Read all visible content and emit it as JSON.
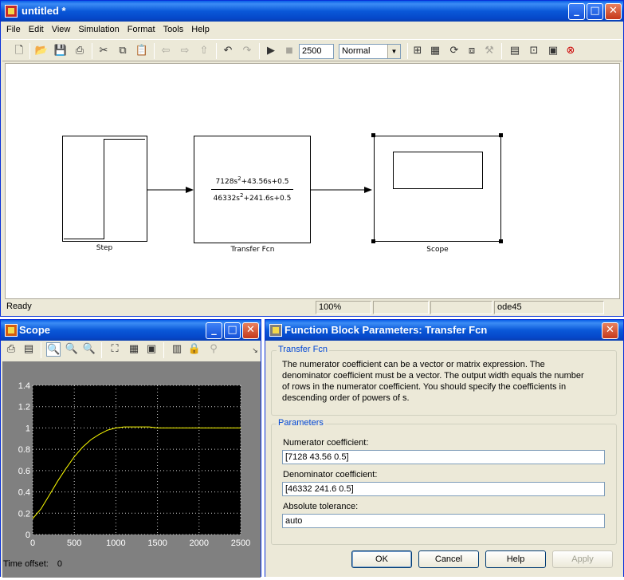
{
  "model": {
    "title": "untitled *",
    "menu": [
      "File",
      "Edit",
      "View",
      "Simulation",
      "Format",
      "Tools",
      "Help"
    ],
    "stop_time": "2500",
    "sim_mode": "Normal",
    "blocks": {
      "step": {
        "label": "Step"
      },
      "tf": {
        "label": "Transfer Fcn",
        "num_a": "7128s",
        "num_b": "+43.56s+0.5",
        "den_a": "46332s",
        "den_b": "+241.6s+0.5",
        "exp": "2"
      },
      "scope": {
        "label": "Scope"
      }
    },
    "status": {
      "ready": "Ready",
      "zoom": "100%",
      "solver": "ode45"
    }
  },
  "scope": {
    "title": "Scope",
    "time_offset_label": "Time offset:",
    "time_offset_value": "0",
    "chart_data": {
      "type": "line",
      "title": "",
      "xlabel": "",
      "ylabel": "",
      "xlim": [
        0,
        2500
      ],
      "ylim": [
        0,
        1.4
      ],
      "xticks": [
        0,
        500,
        1000,
        1500,
        2000,
        2500
      ],
      "yticks": [
        0,
        0.2,
        0.4,
        0.6,
        0.8,
        1,
        1.2,
        1.4
      ],
      "ytick_labels": [
        "0",
        "0.2",
        "0.4",
        "0.6",
        "0.8",
        "1",
        "1.2",
        "1.4"
      ],
      "grid": true,
      "series": [
        {
          "x": [
            0,
            100,
            200,
            300,
            400,
            500,
            600,
            700,
            800,
            900,
            1000,
            1100,
            1200,
            1300,
            1400,
            1500,
            1750,
            2000,
            2250,
            2500
          ],
          "y": [
            0.15,
            0.24,
            0.37,
            0.5,
            0.62,
            0.73,
            0.82,
            0.89,
            0.94,
            0.98,
            1.0,
            1.01,
            1.01,
            1.01,
            1.01,
            1.0,
            1.0,
            1.0,
            1.0,
            1.0
          ]
        }
      ]
    }
  },
  "dialog": {
    "title": "Function Block Parameters: Transfer Fcn",
    "section1_title": "Transfer Fcn",
    "description": "The numerator coefficient can be a vector or matrix expression. The denominator coefficient must be a vector. The output width equals the number of rows in the numerator coefficient. You should specify the coefficients in descending order of powers of s.",
    "section2_title": "Parameters",
    "numerator_label": "Numerator coefficient:",
    "numerator_value": "[7128 43.56 0.5]",
    "denominator_label": "Denominator coefficient:",
    "denominator_value": "[46332 241.6 0.5]",
    "tolerance_label": "Absolute tolerance:",
    "tolerance_value": "auto",
    "buttons": {
      "ok": "OK",
      "cancel": "Cancel",
      "help": "Help",
      "apply": "Apply"
    }
  },
  "colors": {
    "scope_bg": "#000000",
    "scope_line": "#ffff00",
    "xp_title": "#0a58d8"
  },
  "icons": {
    "model": "simulink-icon",
    "scope": "matlab-icon",
    "dialog": "block-params-icon"
  }
}
